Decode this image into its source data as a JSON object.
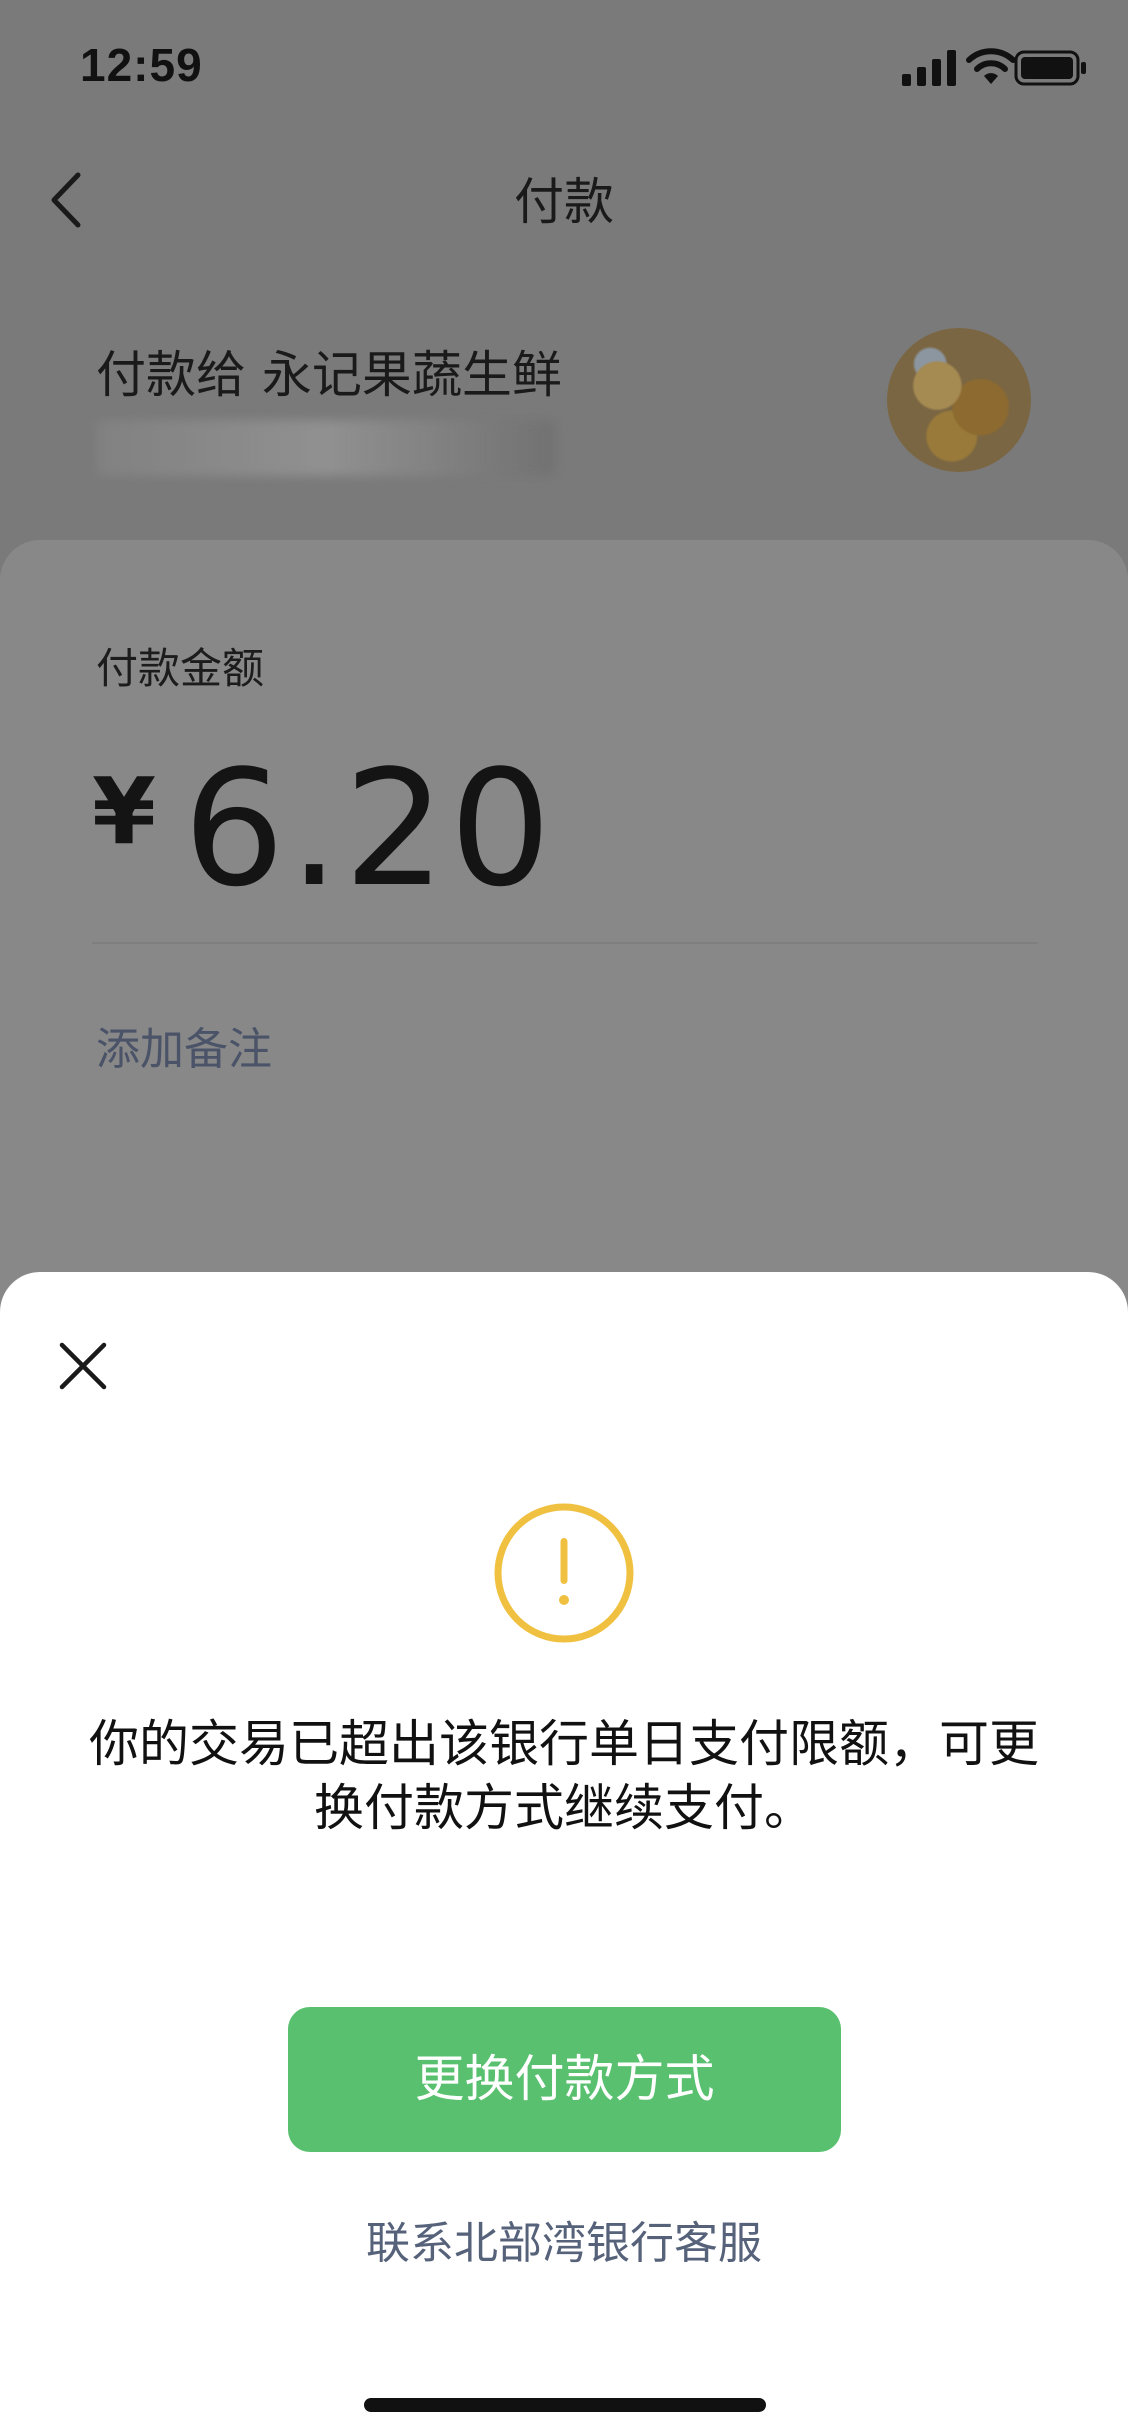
{
  "status_bar": {
    "time": "12:59",
    "icons": [
      "cellular-signal-icon",
      "wifi-icon",
      "battery-icon"
    ]
  },
  "nav": {
    "back_icon": "chevron-left-icon",
    "title": "付款"
  },
  "payee": {
    "label": "付款给 永记果蔬生鲜"
  },
  "payment": {
    "amount_label": "付款金额",
    "currency_symbol": "¥",
    "amount": "6.20",
    "add_note_label": "添加备注"
  },
  "dialog": {
    "close_icon": "close-icon",
    "warning_icon": "exclamation-circle-icon",
    "message": "你的交易已超出该银行单日支付限额，可更换付款方式继续支付。",
    "primary_button": "更换付款方式",
    "secondary_link": "联系北部湾银行客服",
    "colors": {
      "primary": "#58c06e",
      "warning": "#f0c040",
      "link": "#56617a"
    }
  }
}
